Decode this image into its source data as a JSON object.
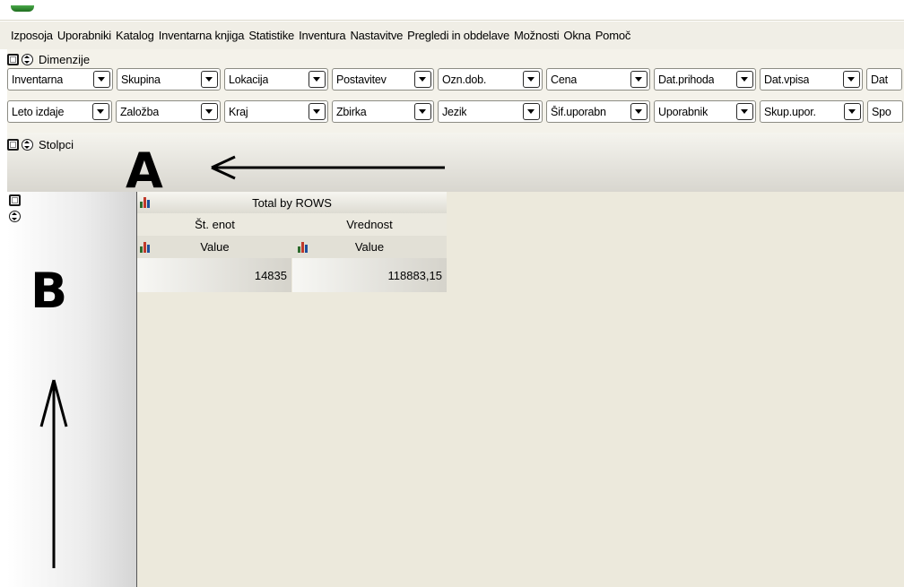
{
  "menu": [
    "Izposoja",
    "Uporabniki",
    "Katalog",
    "Inventarna knjiga",
    "Statistike",
    "Inventura",
    "Nastavitve",
    "Pregledi in obdelave",
    "Možnosti",
    "Okna",
    "Pomoč"
  ],
  "dimensions_panel": {
    "title": "Dimenzije",
    "row1": [
      "Inventarna",
      "Skupina",
      "Lokacija",
      "Postavitev",
      "Ozn.dob.",
      "Cena",
      "Dat.prihoda",
      "Dat.vpisa",
      "Dat"
    ],
    "row2": [
      "Leto izdaje",
      "Založba",
      "Kraj",
      "Zbirka",
      "Jezik",
      "Šif.uporabn",
      "Uporabnik",
      "Skup.upor.",
      "Spo"
    ]
  },
  "columns_panel": {
    "title": "Stolpci"
  },
  "annotations": {
    "a": "A",
    "b": "B"
  },
  "pivot": {
    "title": "Total by ROWS",
    "measures": [
      "Št. enot",
      "Vrednost"
    ],
    "value_label": "Value",
    "values": [
      "14835",
      "118883,15"
    ]
  },
  "icons": {
    "panel_toggle": "square-toggle-icon",
    "panel_sort": "sort-toggle-icon",
    "dropdown": "chevron-down-icon",
    "chart": "bar-chart-icon"
  }
}
